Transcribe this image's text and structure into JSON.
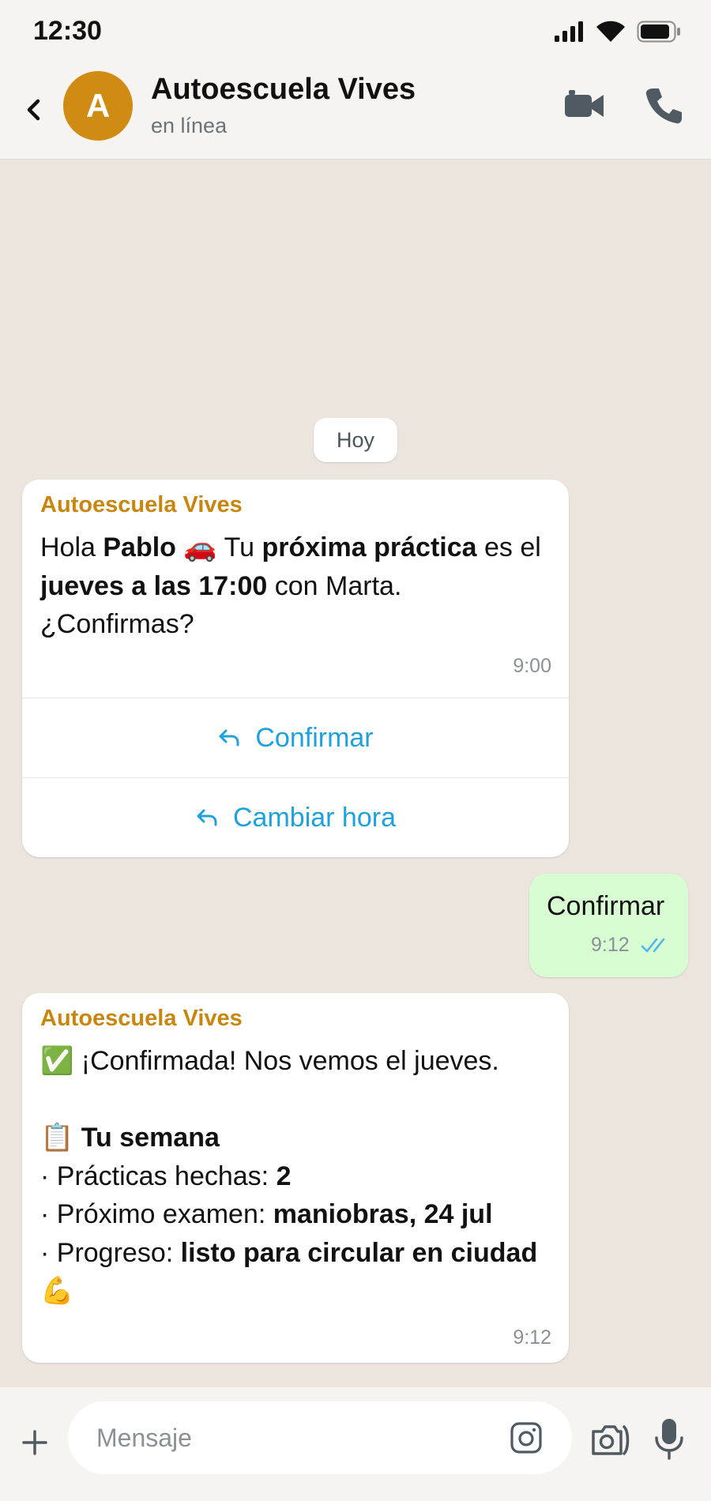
{
  "status_bar": {
    "time": "12:30",
    "icons": [
      "signal-icon",
      "wifi-icon",
      "battery-icon"
    ]
  },
  "header": {
    "avatar_letter": "A",
    "avatar_color": "#d08c12",
    "contact_name": "Autoescuela Vives",
    "contact_status": "en línea",
    "icons": [
      "back-icon",
      "video-call-icon",
      "phone-icon"
    ]
  },
  "chat": {
    "date_label": "Hoy",
    "messages": [
      {
        "sender": "Autoescuela Vives",
        "text_parts": [
          "Hola ",
          "Pablo",
          " 🚗 Tu ",
          "próxima práctica",
          " es el ",
          "jueves a las 17:00",
          " con Marta. ¿Confirmas?"
        ],
        "time": "9:00",
        "quick_replies": [
          "Confirmar",
          "Cambiar hora"
        ]
      },
      {
        "text": "Confirmar",
        "time": "9:12",
        "status_icon": "double-check-icon"
      },
      {
        "sender": "Autoescuela Vives",
        "line1": "✅ ¡Confirmada! Nos vemos el jueves.",
        "week_emoji": "📋",
        "week_title": "Tu semana",
        "practicas_label": "· Prácticas hechas: ",
        "practicas_value": "2",
        "examen_label": "· Próximo examen: ",
        "examen_value": "maniobras, 24 jul",
        "progreso_label": "· Progreso: ",
        "progreso_value": "listo para circular en ciudad",
        "progreso_emoji": "💪",
        "time": "9:12"
      }
    ]
  },
  "composer": {
    "placeholder": "Mensaje",
    "icons": [
      "plus-icon",
      "sticker-icon",
      "camera-icon",
      "mic-icon"
    ]
  },
  "colors": {
    "accent": "#1fa1dd",
    "sender": "#c9860f",
    "outgoing_bubble": "#d9fdd3",
    "chat_background": "#ece5dd"
  }
}
